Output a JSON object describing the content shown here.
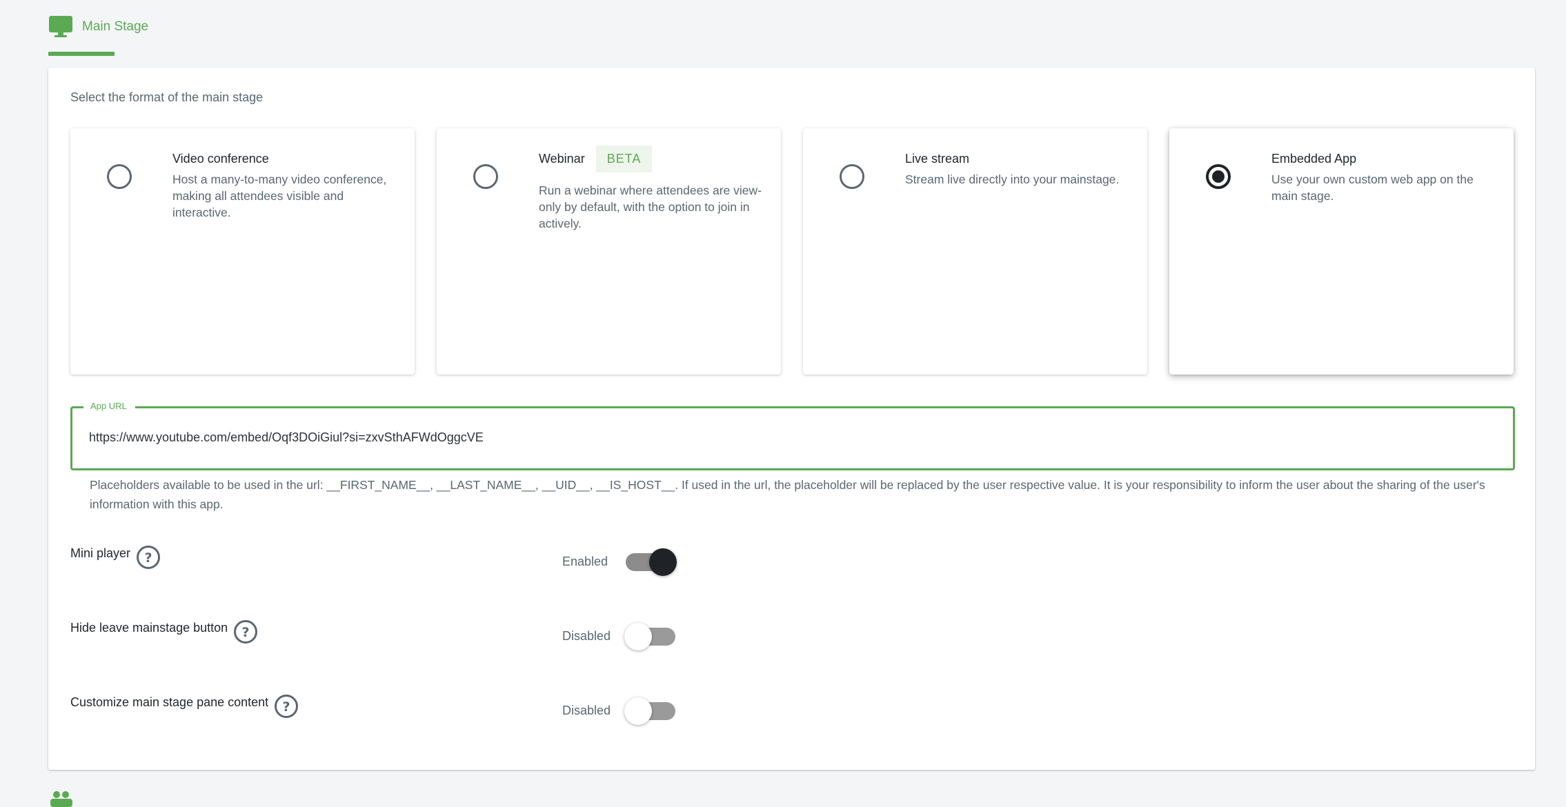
{
  "tab": {
    "label": "Main Stage",
    "icon": "monitor-icon",
    "accent_color": "#5aaa53"
  },
  "main_stage": {
    "section_label": "Select the format of the main stage",
    "options": [
      {
        "title": "Video conference",
        "badge": "",
        "description": "Host a many-to-many video conference, making all attendees visible and interactive.",
        "selected": false
      },
      {
        "title": "Webinar",
        "badge": "BETA",
        "description": "Run a webinar where attendees are view-only by default, with the option to join in actively.",
        "selected": false
      },
      {
        "title": "Live stream",
        "badge": "",
        "description": "Stream live directly into your mainstage.",
        "selected": false
      },
      {
        "title": "Embedded App",
        "badge": "",
        "description": "Use your own custom web app on the main stage.",
        "selected": true
      }
    ]
  },
  "app_url": {
    "label": "App URL",
    "value": "https://www.youtube.com/embed/Oqf3DOiGiul?si=zxvSthAFWdOggcVE",
    "help": "Placeholders available to be used in the url: __FIRST_NAME__, __LAST_NAME__, __UID__, __IS_HOST__. If used in the url, the placeholder will be replaced by the user respective value. It is your responsibility to inform the user about the sharing of the user's information with this app."
  },
  "settings": [
    {
      "label": "Mini player",
      "state": "Enabled",
      "on": true
    },
    {
      "label": "Hide leave mainstage button",
      "state": "Disabled",
      "on": false
    },
    {
      "label": "Customize main stage pane content",
      "state": "Disabled",
      "on": false
    }
  ],
  "next_section": {
    "icon": "people-icon"
  }
}
